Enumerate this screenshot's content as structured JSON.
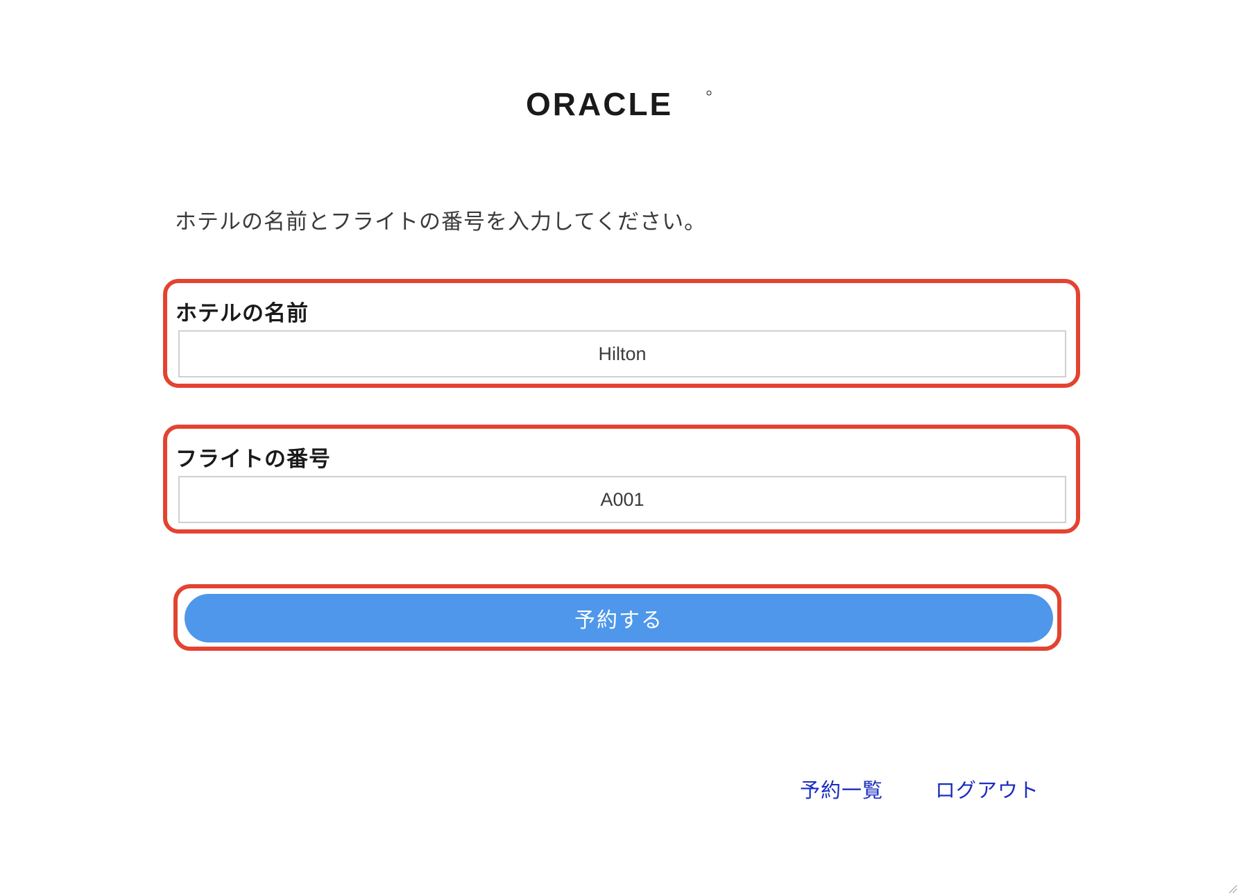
{
  "brand": {
    "logo_text": "ORACLE"
  },
  "instruction": "ホテルの名前とフライトの番号を入力してください。",
  "form": {
    "hotel": {
      "label": "ホテルの名前",
      "value": "Hilton"
    },
    "flight": {
      "label": "フライトの番号",
      "value": "A001"
    },
    "submit_label": "予約する"
  },
  "footer": {
    "reservations_link": "予約一覧",
    "logout_link": "ログアウト"
  },
  "colors": {
    "highlight_border": "#e34330",
    "button_bg": "#4e97ea",
    "link": "#1a2dbf"
  }
}
